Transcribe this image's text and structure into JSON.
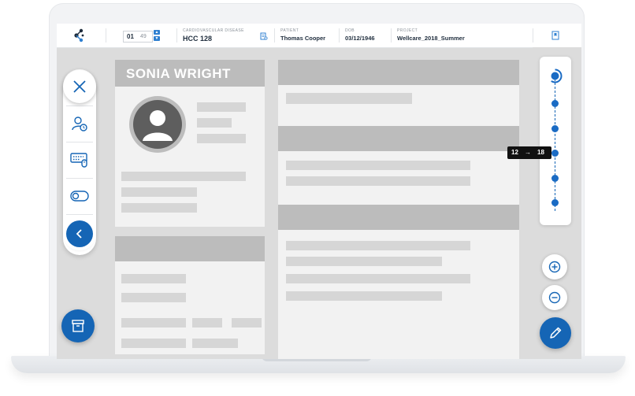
{
  "header": {
    "page_current": "01",
    "page_total": "49",
    "condition_label": "CARDIOVASCULAR DISEASE",
    "condition_value": "HCC 128",
    "patient_label": "PATIENT",
    "patient_value": "Thomas Cooper",
    "dob_label": "DOB",
    "dob_value": "03/12/1946",
    "project_label": "PROJECT",
    "project_value": "Wellcare_2018_Summer"
  },
  "document": {
    "card_name": "SONIA WRIGHT"
  },
  "timeline": {
    "tooltip_from": "12",
    "tooltip_arrow": "→",
    "tooltip_to": "18"
  },
  "colors": {
    "accent": "#1565b5",
    "placeholder": "#d6d6d6",
    "header_bar": "#bcbcbc"
  },
  "icons": [
    "logo-icon",
    "page-up-icon",
    "page-down-icon",
    "document-icon",
    "bookmark-icon",
    "close-icon",
    "user-clock-icon",
    "keyboard-mouse-icon",
    "toggle-icon",
    "chevron-left-icon",
    "archive-icon",
    "zoom-in-icon",
    "zoom-out-icon",
    "pencil-icon"
  ]
}
